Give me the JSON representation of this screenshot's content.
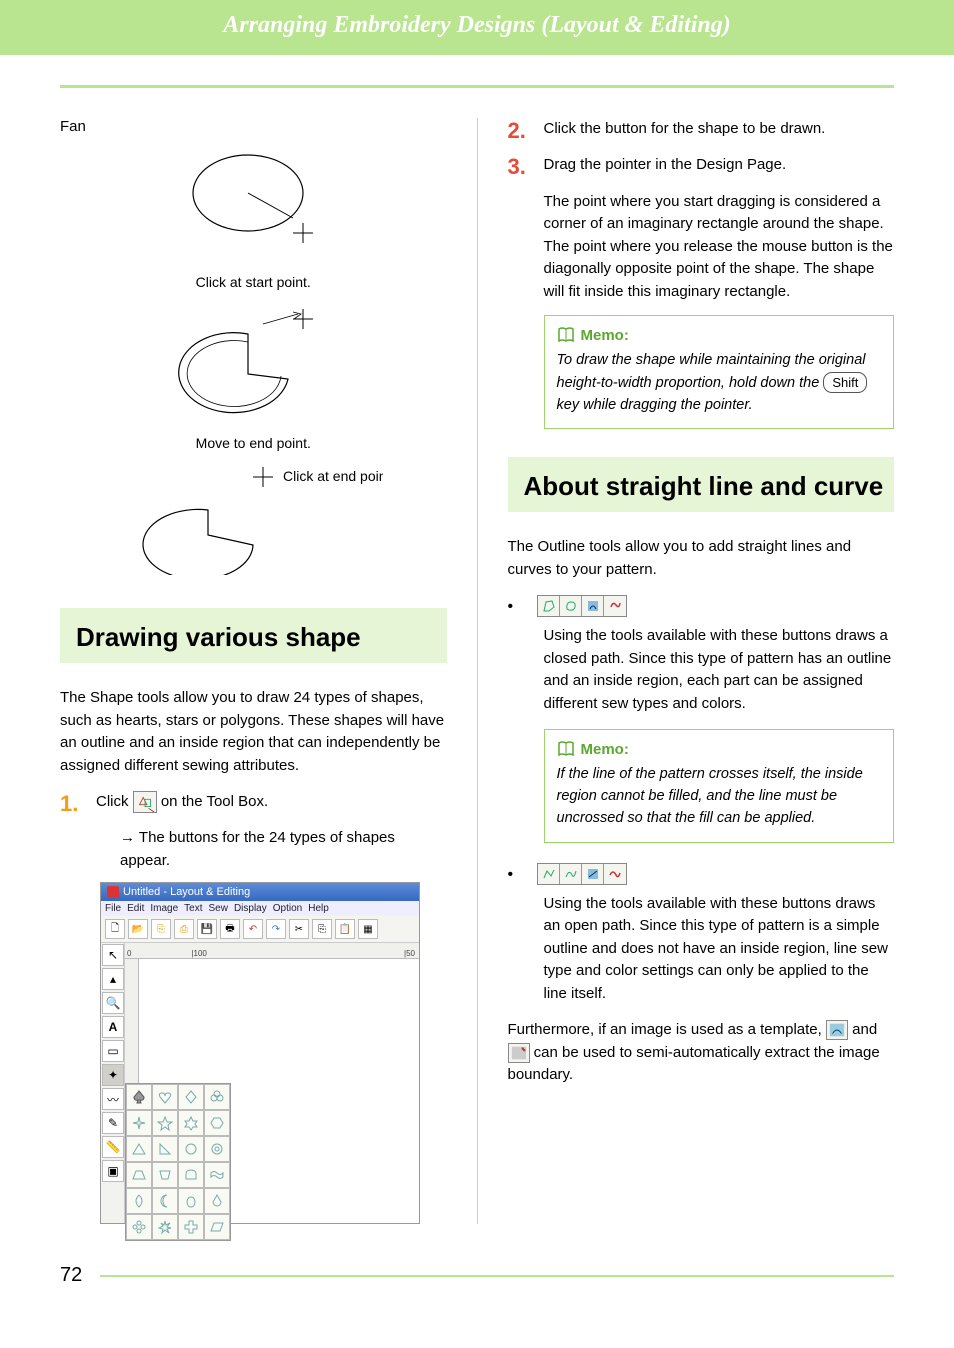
{
  "banner": {
    "title": "Arranging Embroidery Designs (Layout & Editing)"
  },
  "left": {
    "fan_label": "Fan",
    "caption_start": "Click at start point.",
    "caption_move": "Move to end point.",
    "caption_end": "Click at end point.",
    "heading_shapes": "Drawing various shape",
    "shapes_intro": "The Shape tools allow you to draw 24 types of shapes, such as hearts, stars or polygons. These shapes will have an outline and an inside region that can independently be assigned different sewing attributes.",
    "step1_pre": "Click ",
    "step1_post": " on the Tool Box.",
    "step1_sub": "The buttons for the 24 types of shapes appear.",
    "screenshot": {
      "title": "Untitled - Layout & Editing",
      "menus": [
        "File",
        "Edit",
        "Image",
        "Text",
        "Sew",
        "Display",
        "Option",
        "Help"
      ],
      "ruler_marks": [
        "0",
        "100",
        "50"
      ]
    }
  },
  "right": {
    "step2": "Click the button for the shape to be drawn.",
    "step3": "Drag the pointer in the Design Page.",
    "step3_detail": "The point where you start dragging is considered a corner of an imaginary rectangle around the shape. The point where you release the mouse button is the diagonally opposite point of the shape. The shape will fit inside this imaginary rectangle.",
    "memo1_head": "Memo:",
    "memo1_body_pre": "To draw the shape while maintaining the original height-to-width proportion, hold down the ",
    "memo1_key": "Shift",
    "memo1_body_post": " key while dragging the pointer.",
    "heading_line": "About straight line and curve",
    "line_intro": "The Outline tools allow you to add straight lines and curves to your pattern.",
    "closed_para": "Using the tools available with these buttons draws a closed path. Since this type of pattern has an outline and an inside region, each part can be assigned different sew types and colors.",
    "memo2_head": "Memo:",
    "memo2_body": "If the line of the pattern crosses itself, the inside region cannot be filled, and the line must be uncrossed so that the fill can be applied.",
    "open_para": "Using the tools available with these buttons draws an open path. Since this type of pattern is a simple outline and does not have an inside region, line sew type and color settings can only be applied to the line itself.",
    "template_pre": "Furthermore, if an image is used as a template, ",
    "template_mid": " and ",
    "template_post": " can be used to semi-automatically extract the image boundary."
  },
  "page_number": "72"
}
